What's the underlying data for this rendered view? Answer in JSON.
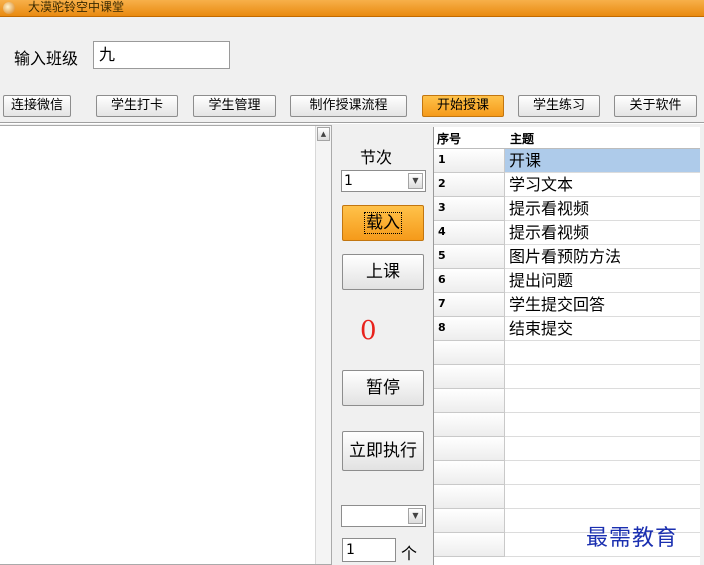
{
  "window": {
    "title": "大漠驼铃空中课堂"
  },
  "class_input": {
    "label": "输入班级",
    "value": "九"
  },
  "toolbar": {
    "buttons": [
      {
        "label": "连接微信"
      },
      {
        "label": "学生打卡"
      },
      {
        "label": "学生管理"
      },
      {
        "label": "制作授课流程"
      },
      {
        "label": "开始授课",
        "active": true
      },
      {
        "label": "学生练习"
      },
      {
        "label": "关于软件"
      }
    ]
  },
  "controls": {
    "section_label": "节次",
    "section_select": "1",
    "load_label": "载入",
    "start_label": "上课",
    "counter": "0",
    "pause_label": "暂停",
    "run_now_label": "立即执行",
    "second_select": "",
    "count_value": "1",
    "count_unit": "个"
  },
  "table": {
    "headers": {
      "no": "序号",
      "topic": "主题"
    },
    "rows": [
      {
        "no": "1",
        "topic": "开课"
      },
      {
        "no": "2",
        "topic": "学习文本"
      },
      {
        "no": "3",
        "topic": "提示看视频"
      },
      {
        "no": "4",
        "topic": "提示看视频"
      },
      {
        "no": "5",
        "topic": "图片看预防方法"
      },
      {
        "no": "6",
        "topic": "提出问题"
      },
      {
        "no": "7",
        "topic": "学生提交回答"
      },
      {
        "no": "8",
        "topic": "结束提交"
      },
      {
        "no": "",
        "topic": ""
      },
      {
        "no": "",
        "topic": ""
      },
      {
        "no": "",
        "topic": ""
      },
      {
        "no": "",
        "topic": ""
      },
      {
        "no": "",
        "topic": ""
      },
      {
        "no": "",
        "topic": ""
      },
      {
        "no": "",
        "topic": ""
      },
      {
        "no": "",
        "topic": ""
      },
      {
        "no": "",
        "topic": ""
      }
    ],
    "selected_row": "1"
  },
  "watermark": "最需教育",
  "colors": {
    "accent_orange": "#f59a1a",
    "selection_blue": "#aecbea",
    "counter_red": "#e8221c",
    "watermark_blue": "#1a2fb0"
  }
}
